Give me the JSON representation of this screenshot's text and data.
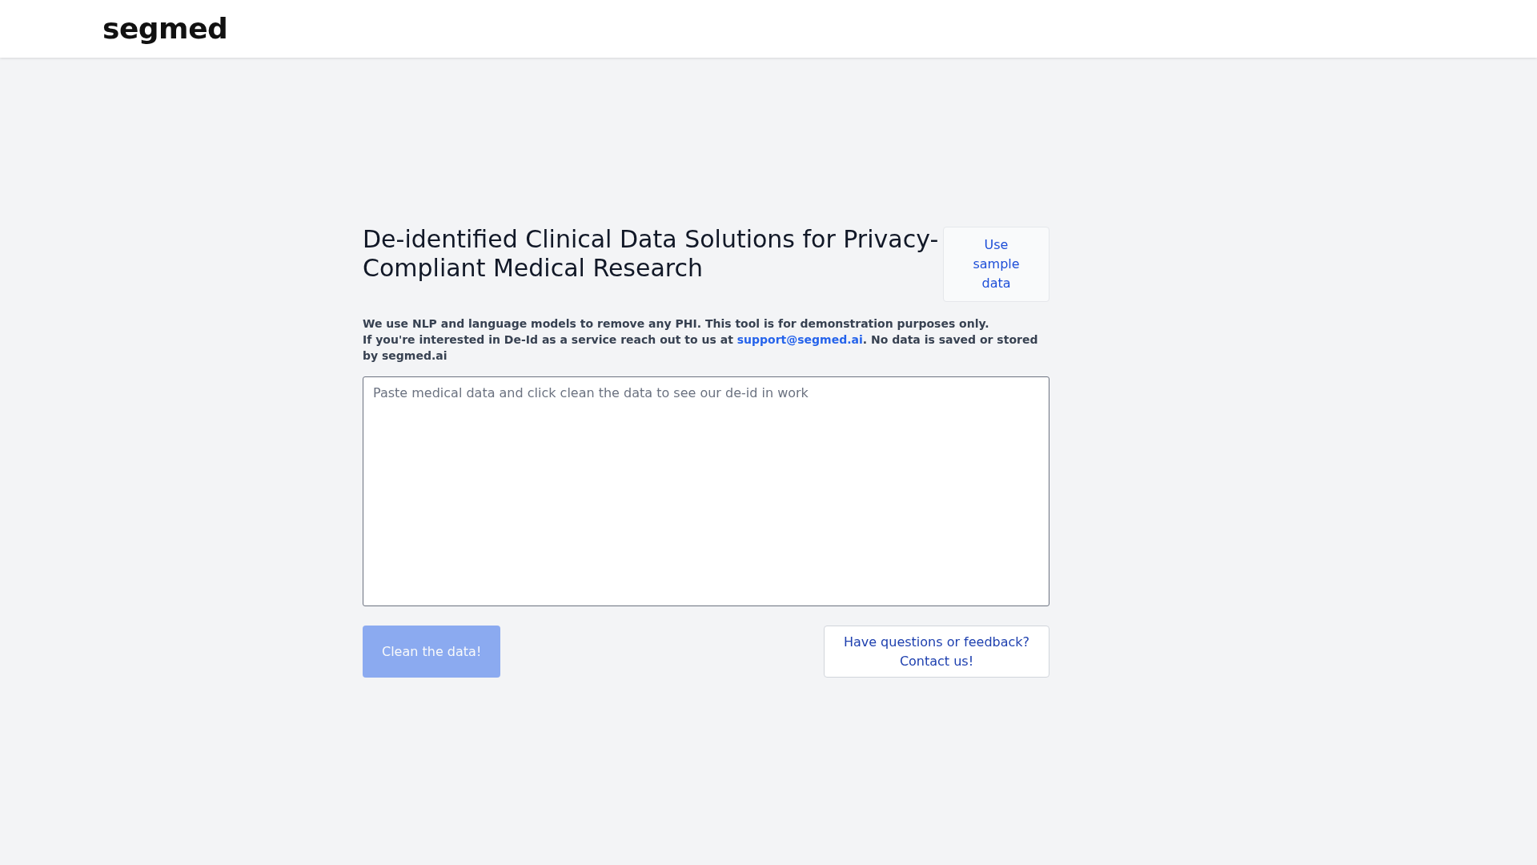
{
  "header": {
    "logo": "segmed"
  },
  "intro": {
    "title": "De-identified Clinical Data Solutions for Privacy-Compliant Medical Research",
    "sample_button": "Use sample data"
  },
  "notice": {
    "sentence_1": "We use NLP and language models to remove any PHI. This tool is for demonstration purposes only.",
    "text_before_link": "If you're interested in De-Id as a service reach out to us at",
    "link": "support@segmed.ai",
    "text_after_link": ". No data is saved or stored by segmed.ai"
  },
  "input": {
    "placeholder": "Paste medical data and click clean the data to see our de-id in work"
  },
  "actions": {
    "clean_button": {
      "label": "Clean the data!",
      "disabled": true
    },
    "contact_button": {
      "label": "Have questions or feedback? Contact us!"
    }
  }
}
